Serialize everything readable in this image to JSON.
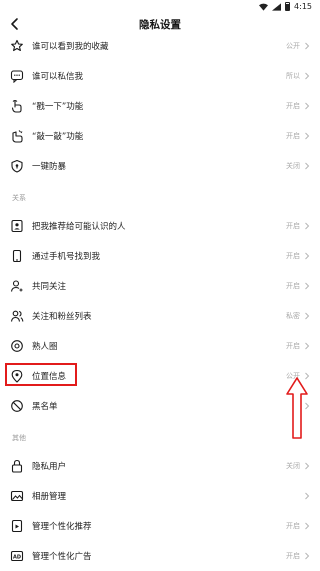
{
  "status_bar": {
    "time": "4:15",
    "left_text": ""
  },
  "header": {
    "title": "隐私设置"
  },
  "sections": [
    {
      "header": "",
      "items": [
        {
          "icon": "star-icon",
          "label": "谁可以看到我的收藏",
          "value": "公开"
        },
        {
          "icon": "message-icon",
          "label": "谁可以私信我",
          "value": "所以"
        },
        {
          "icon": "poke-hand-icon",
          "label": "“戳一下”功能",
          "value": "开启"
        },
        {
          "icon": "knock-hand-icon",
          "label": "“敲一敲”功能",
          "value": "开启"
        },
        {
          "icon": "shield-icon",
          "label": "一键防暴",
          "value": "关闭"
        }
      ]
    },
    {
      "header": "关系",
      "items": [
        {
          "icon": "contact-card-icon",
          "label": "把我推荐给可能认识的人",
          "value": "开启"
        },
        {
          "icon": "phone-icon",
          "label": "通过手机号找到我",
          "value": "开启"
        },
        {
          "icon": "person-icon",
          "label": "共同关注",
          "value": "开启"
        },
        {
          "icon": "people-icon",
          "label": "关注和粉丝列表",
          "value": "私密"
        },
        {
          "icon": "circle-icon",
          "label": "熟人圈",
          "value": "开启"
        },
        {
          "icon": "location-pin-icon",
          "label": "位置信息",
          "value": "公开"
        },
        {
          "icon": "block-icon",
          "label": "黑名单",
          "value": ""
        }
      ]
    },
    {
      "header": "其他",
      "items": [
        {
          "icon": "lock-icon",
          "label": "隐私用户",
          "value": "关闭"
        },
        {
          "icon": "image-icon",
          "label": "相册管理",
          "value": ""
        },
        {
          "icon": "recommend-icon",
          "label": "管理个性化推荐",
          "value": "开启"
        },
        {
          "icon": "ad-icon",
          "label": "管理个性化广告",
          "value": "开启"
        }
      ]
    }
  ],
  "annotation": {
    "highlight_color": "#e21b1b"
  }
}
